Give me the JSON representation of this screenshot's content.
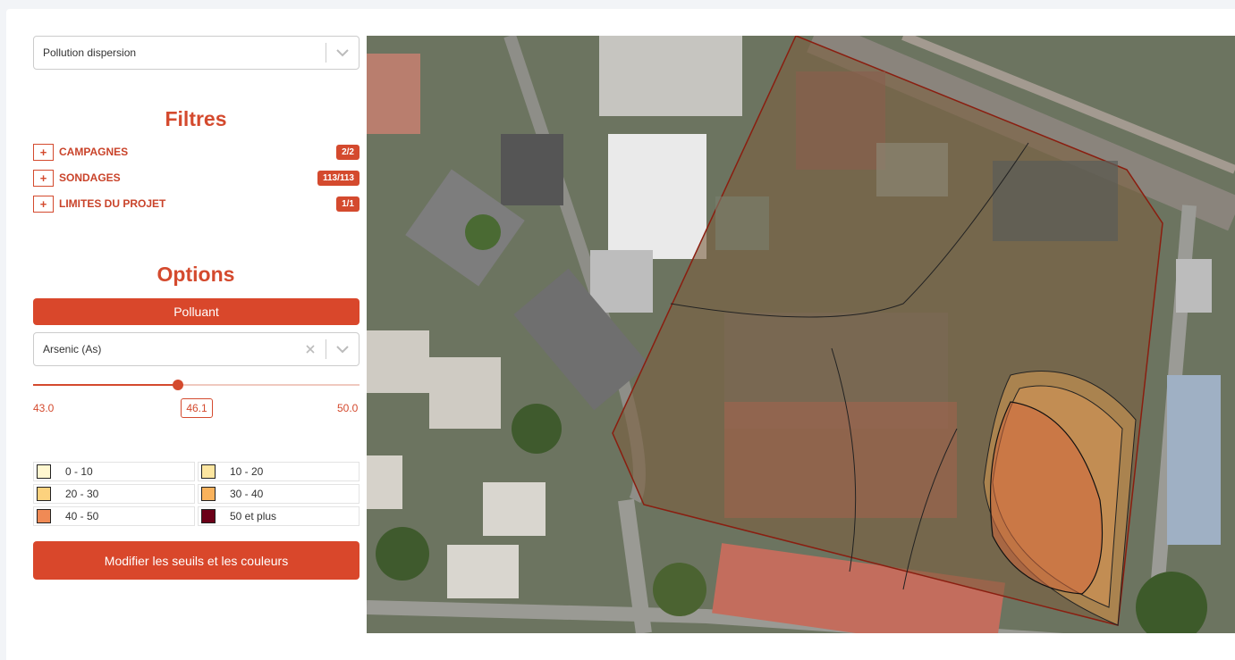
{
  "layer_select": {
    "value": "Pollution dispersion"
  },
  "filters": {
    "title": "Filtres",
    "items": [
      {
        "toggle": "+",
        "label": "CAMPAGNES",
        "count": "2/2"
      },
      {
        "toggle": "+",
        "label": "SONDAGES",
        "count": "113/113"
      },
      {
        "toggle": "+",
        "label": "LIMITES DU PROJET",
        "count": "1/1"
      }
    ]
  },
  "options": {
    "title": "Options",
    "polluant_button": "Polluant",
    "pollutant_select": {
      "value": "Arsenic (As)"
    },
    "slider": {
      "min": "43.0",
      "max": "50.0",
      "value": "46.1"
    },
    "legend": [
      {
        "label": "0 - 10",
        "color": "#fff7d0"
      },
      {
        "label": "10 - 20",
        "color": "#fde6a0"
      },
      {
        "label": "20 - 30",
        "color": "#fcd27e"
      },
      {
        "label": "30 - 40",
        "color": "#f9b25c"
      },
      {
        "label": "40 - 50",
        "color": "#f08a55"
      },
      {
        "label": "50 et plus",
        "color": "#6b0018"
      }
    ],
    "modify_button": "Modifier les seuils et les couleurs"
  },
  "colors": {
    "accent": "#d44a2e"
  }
}
